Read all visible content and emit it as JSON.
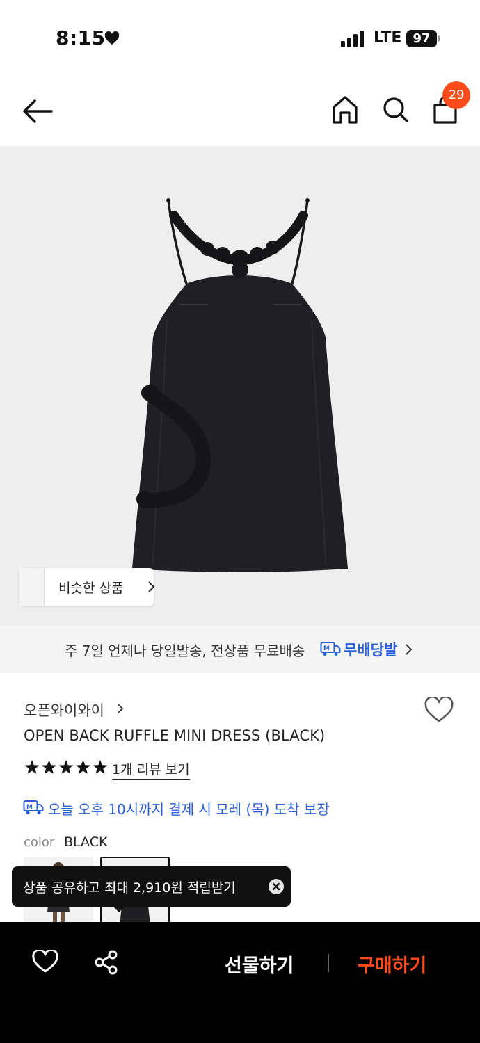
{
  "status_bar": {
    "time": "8:15",
    "network": "LTE",
    "battery": "97"
  },
  "nav": {
    "cart_count": "29"
  },
  "hero": {
    "similar_label": "비슷한 상품"
  },
  "banner": {
    "text": "주 7일 언제나 당일발송, 전상품 무료배송",
    "brand": "무배당발"
  },
  "product": {
    "store": "오픈와이와이",
    "name": "OPEN BACK RUFFLE MINI DRESS (BLACK)",
    "rating_stars": 5,
    "review_link": "1개 리뷰 보기",
    "delivery": "오늘 오후 10시까지 결제 시 모레 (목) 도착 보장",
    "color_label": "color",
    "color_value": "BLACK"
  },
  "tooltip": {
    "text": "상품 공유하고 최대 2,910원 적립받기"
  },
  "bottom_bar": {
    "gift_label": "선물하기",
    "buy_label": "구매하기"
  },
  "colors": {
    "accent": "#ff4a1c",
    "link_blue": "#2b5fd9",
    "hero_bg": "#eeeeef"
  }
}
